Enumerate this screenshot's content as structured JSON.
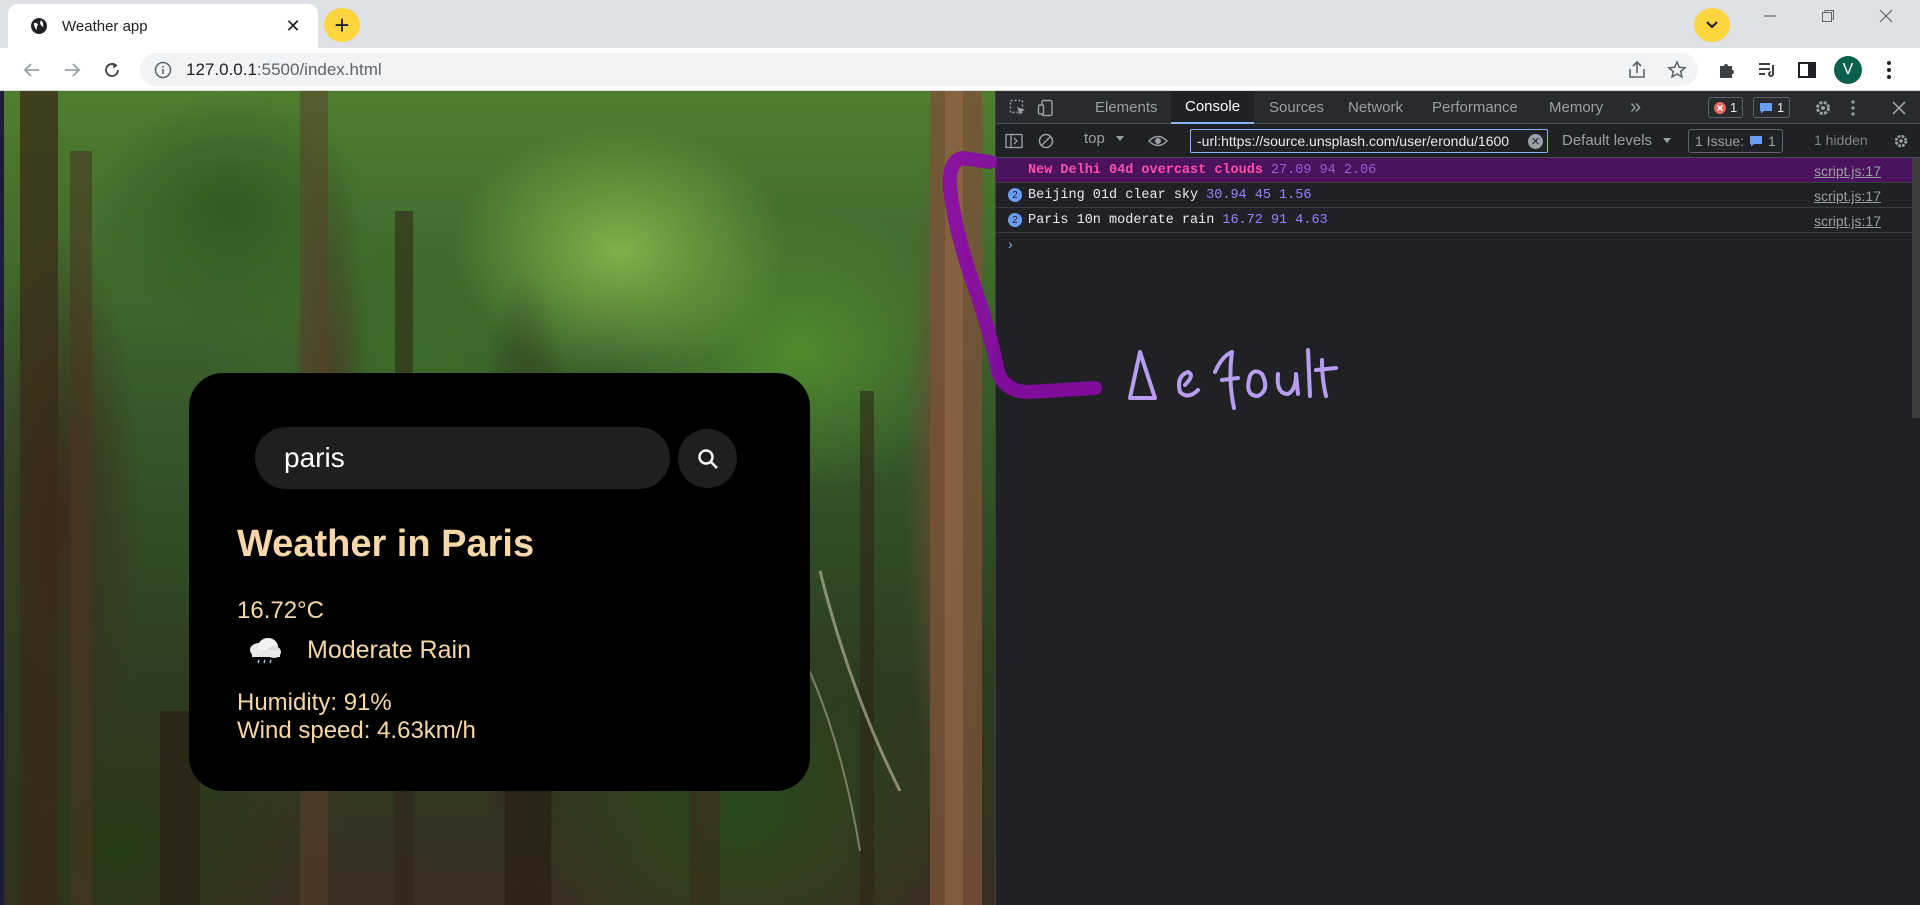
{
  "browser": {
    "tab_title": "Weather app",
    "tab_close": "✕",
    "new_tab": "+",
    "url_host": "127.0.0.1",
    "url_rest": ":5500/index.html",
    "profile_initial": "V",
    "brand_yellow": "#fcd53f"
  },
  "weather_card": {
    "search_value": "paris",
    "city_heading": "Weather in Paris",
    "temperature": "16.72°C",
    "description": "Moderate Rain",
    "humidity": "Humidity: 91%",
    "wind": "Wind speed: 4.63km/h",
    "text_color": "#f7d7a8"
  },
  "devtools": {
    "tabs": [
      "Elements",
      "Console",
      "Sources",
      "Network",
      "Performance",
      "Memory"
    ],
    "more_tabs": "»",
    "error_count": "1",
    "message_count": "1",
    "context": "top",
    "filter_value": "-url:https://source.unsplash.com/user/erondu/1600",
    "levels": "Default levels",
    "issue_label": "1 Issue:",
    "issue_count": "1",
    "hidden_label": "1 hidden",
    "logs": [
      {
        "text": "New Delhi 04d overcast clouds",
        "nums": "27.09 94 2.06",
        "source": "script.js:17"
      },
      {
        "count": "2",
        "text": "Beijing 01d clear sky",
        "nums": "30.94 45 1.56",
        "source": "script.js:17"
      },
      {
        "count": "2",
        "text": "Paris 10n moderate rain",
        "nums": "16.72 91 4.63",
        "source": "script.js:17"
      }
    ],
    "prompt": "›"
  },
  "annotation": {
    "handwritten_label": "Default",
    "color": "#8a0aa8"
  }
}
